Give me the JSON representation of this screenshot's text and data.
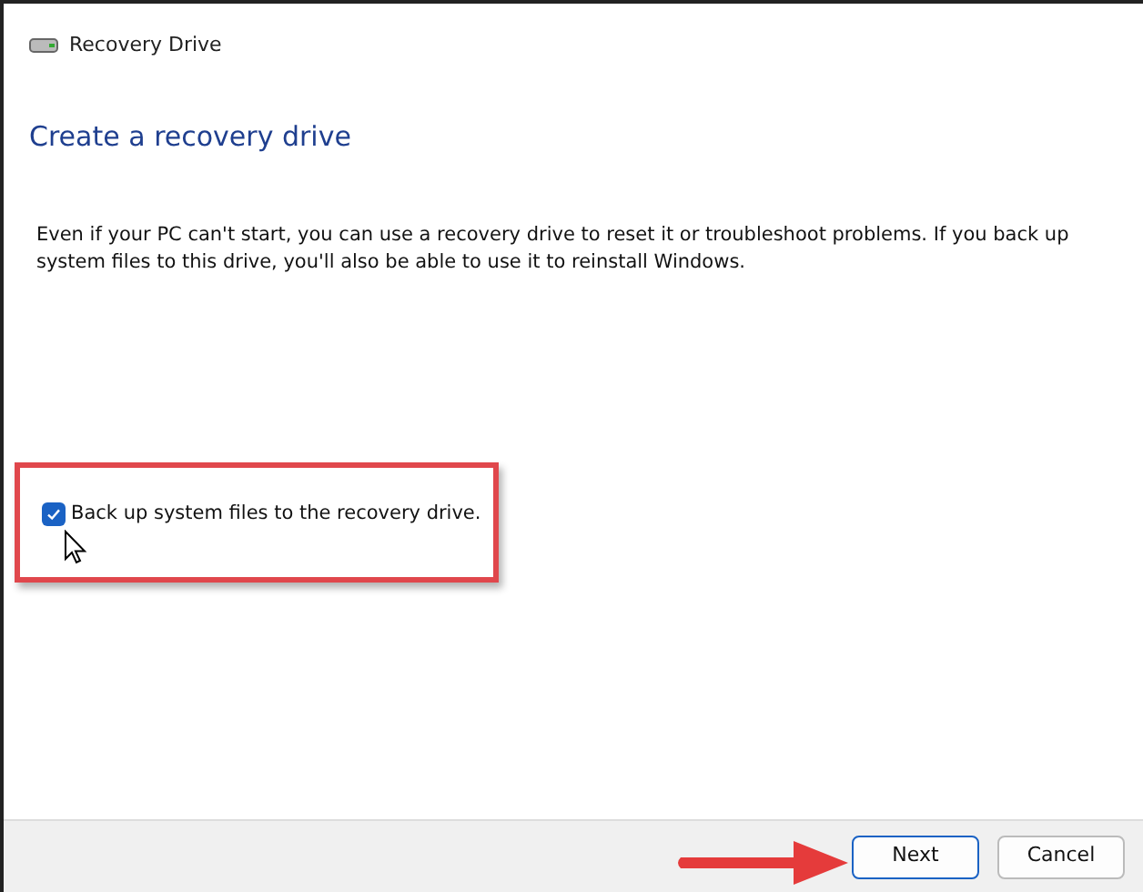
{
  "window": {
    "title": "Recovery Drive"
  },
  "heading": "Create a recovery drive",
  "description": "Even if your PC can't start, you can use a recovery drive to reset it or troubleshoot problems. If you back up system files to this drive, you'll also be able to use it to reinstall Windows.",
  "option": {
    "label": "Back up system files to the recovery drive.",
    "checked": true
  },
  "buttons": [
    {
      "label": "Next",
      "kind": "primary"
    },
    {
      "label": "Cancel",
      "kind": "secondary"
    }
  ]
}
